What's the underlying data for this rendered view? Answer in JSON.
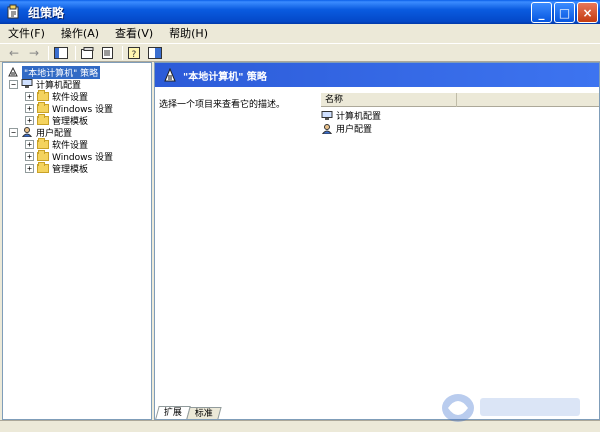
{
  "window": {
    "title": "组策略",
    "buttons": {
      "minimize": "_",
      "maximize": "□",
      "close": "×"
    }
  },
  "menu": {
    "items": [
      "文件(F)",
      "操作(A)",
      "查看(V)",
      "帮助(H)"
    ]
  },
  "toolbar": {
    "icons": [
      "back-icon",
      "forward-icon",
      "show-hide-tree-icon",
      "properties-icon",
      "export-list-icon",
      "help-icon",
      "console-tree-icon"
    ]
  },
  "tree": {
    "root": "\"本地计算机\" 策略",
    "computer_config": "计算机配置",
    "user_config": "用户配置",
    "software_settings": "软件设置",
    "windows_settings": "Windows 设置",
    "admin_templates": "管理模板",
    "expander_glyph": "+",
    "collapse_glyph": "−"
  },
  "right": {
    "header_title": "\"本地计算机\" 策略",
    "description": "选择一个项目来查看它的描述。",
    "column_name": "名称",
    "items": [
      "计算机配置",
      "用户配置"
    ]
  },
  "tabs": [
    "扩展",
    "标准"
  ]
}
